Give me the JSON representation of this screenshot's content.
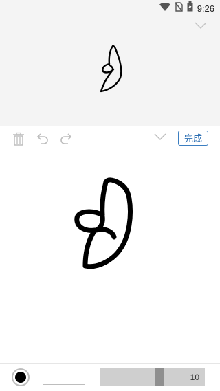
{
  "status_bar": {
    "time": "9:26",
    "icons": [
      "wifi-icon",
      "no-sim-icon",
      "battery-charging-icon"
    ]
  },
  "toolbar": {
    "icons": [
      "trash-icon",
      "undo-icon",
      "redo-icon",
      "chevron-down-icon"
    ],
    "done_label": "完成"
  },
  "pen": {
    "color": "#000000",
    "size_value": "10",
    "size_fraction": 0.57
  },
  "colors": {
    "accent": "#3b7ec1",
    "preview_bg": "#f4f4f4",
    "icon_gray": "#b9b9b9"
  }
}
